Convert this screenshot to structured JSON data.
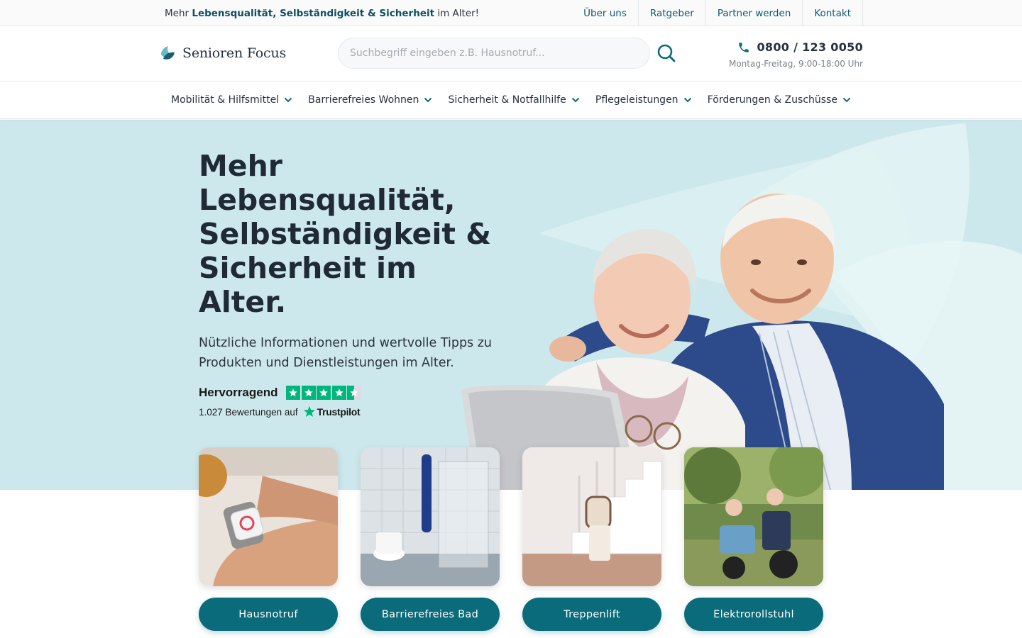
{
  "topbar": {
    "tagline_prefix": "Mehr",
    "tagline_bold": "Lebensqualität, Selbständigkeit & Sicherheit",
    "tagline_suffix": "im Alter!",
    "links": [
      {
        "label": "Über uns"
      },
      {
        "label": "Ratgeber"
      },
      {
        "label": "Partner werden"
      },
      {
        "label": "Kontakt"
      }
    ]
  },
  "header": {
    "logo_text": "Senioren Focus",
    "search_placeholder": "Suchbegriff eingeben z.B. Hausnotruf...",
    "phone_number": "0800 / 123 0050",
    "phone_hours": "Montag-Freitag, 9:00-18:00 Uhr"
  },
  "nav": {
    "items": [
      {
        "label": "Mobilität & Hilfsmittel"
      },
      {
        "label": "Barrierefreies Wohnen"
      },
      {
        "label": "Sicherheit & Notfallhilfe"
      },
      {
        "label": "Pflegeleistungen"
      },
      {
        "label": "Förderungen & Zuschüsse"
      }
    ]
  },
  "hero": {
    "title": "Mehr Lebensqualität, Selbständigkeit & Sicherheit im Alter.",
    "subtitle": "Nützliche Informationen und wertvolle Tipps zu Produkten und Dienstleistungen im Alter."
  },
  "trustpilot": {
    "rating_label": "Hervorragend",
    "stars": 4.5,
    "reviews_text": "1.027 Bewertungen auf",
    "brand": "Trustpilot"
  },
  "cards": [
    {
      "label": "Hausnotruf",
      "icon": "emergency-watch-image"
    },
    {
      "label": "Barrierefreies Bad",
      "icon": "accessible-bathroom-image"
    },
    {
      "label": "Treppenlift",
      "icon": "stairlift-image"
    },
    {
      "label": "Elektrorollstuhl",
      "icon": "electric-wheelchair-image"
    }
  ],
  "colors": {
    "brand": "#0a6b7b",
    "hero_bg": "#cde8ec",
    "trustpilot_green": "#00b67a",
    "text_dark": "#1f2a36"
  }
}
